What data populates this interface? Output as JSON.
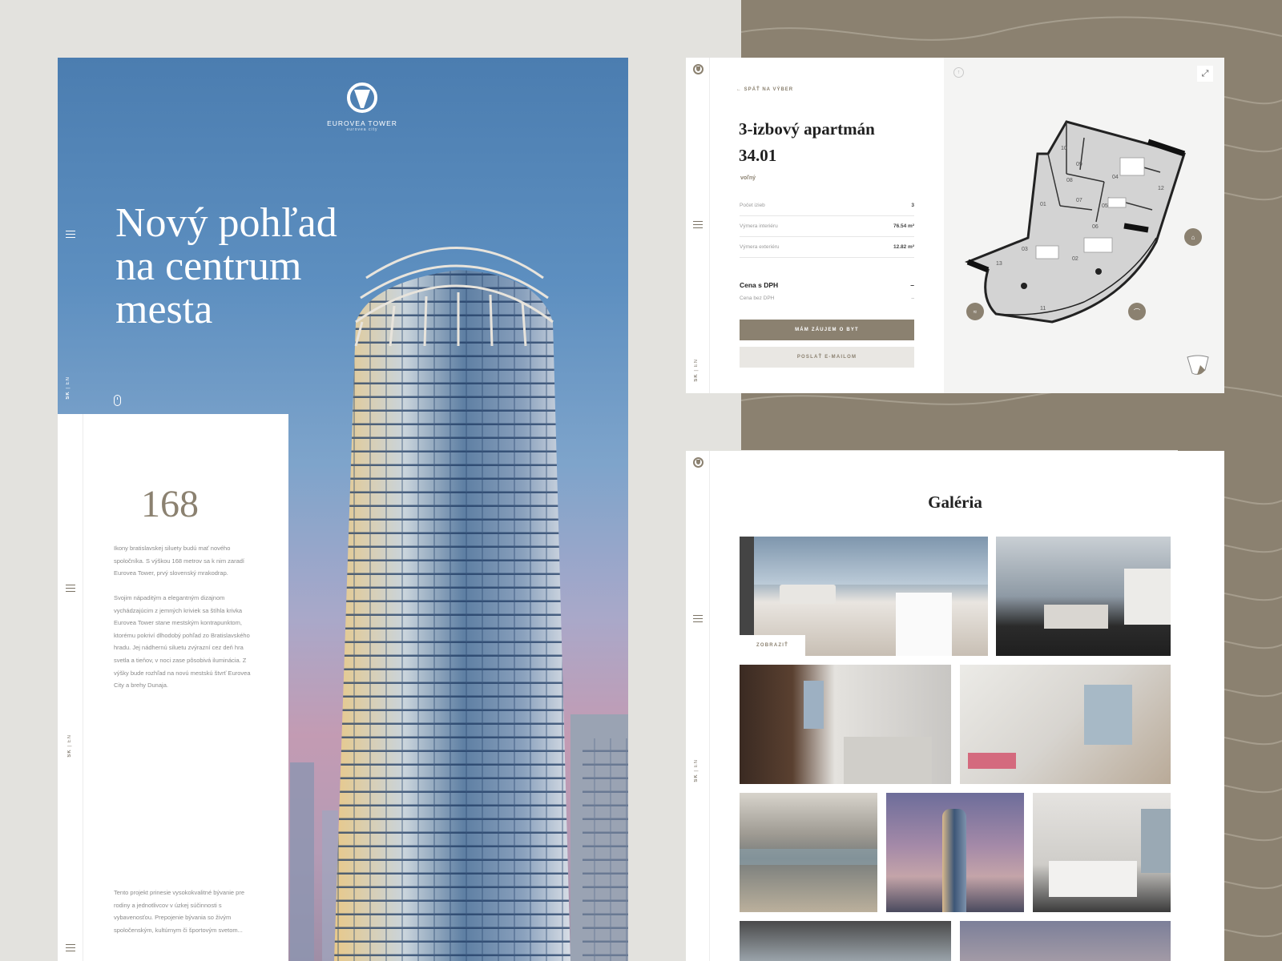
{
  "hero": {
    "brand": "EUROVEA TOWER",
    "brand_sub": "eurovea city",
    "title_lines": [
      "Nový pohľad",
      "na centrum",
      "mesta"
    ],
    "lang_sk": "SK",
    "lang_sep": "|",
    "lang_en": "EN"
  },
  "info": {
    "number": "168",
    "para1": "Ikony bratislavskej siluety budú mať nového spoločníka. S výškou 168 metrov sa k nim zaradí Eurovea Tower, prvý slovenský mrakodrap.",
    "para2": "Svojim nápaditým a elegantným dizajnom vychádzajúcim z jemných kriviek sa štíhla krivka Eurovea Tower stane mestským kontrapunktom, ktorému pokriví dlhodobý pohľad zo Bratislavského hradu. Jej nádhernú siluetu zvýrazní cez deň hra svetla a tieňov, v noci zase pôsobivá iluminácia. Z výšky bude rozhľad na novú mestskú štvrť Eurovea City a brehy Dunaja.",
    "para3": "Tento projekt prinesie vysokokvalitné bývanie pre rodiny a jednotlivcov v úzkej súčinnosti s vybavenosťou. Prepojenie bývania so živým spoločenským, kultúrnym či športovým svetom..."
  },
  "apartment": {
    "back": "← SPÄŤ NA VÝBER",
    "title_line1": "3-izbový apartmán",
    "title_line2": "34.01",
    "status": "voľný",
    "specs": [
      {
        "label": "Počet izieb",
        "value": "3"
      },
      {
        "label": "Výmera interiéru",
        "value": "76.54 m²"
      },
      {
        "label": "Výmera exteriéru",
        "value": "12.82 m²"
      }
    ],
    "price_label": "Cena s DPH",
    "price_value": "–",
    "price_net_label": "Cena bez DPH",
    "price_net_value": "–",
    "btn_interest": "MÁM ZÁUJEM O BYT",
    "btn_email": "POSLAŤ E-MAILOM",
    "room_numbers": [
      "01",
      "02",
      "03",
      "04",
      "05",
      "06",
      "07",
      "08",
      "09",
      "10",
      "11",
      "12",
      "13"
    ]
  },
  "gallery": {
    "title": "Galéria",
    "show": "ZOBRAZIŤ"
  },
  "colors": {
    "accent": "#8b8170",
    "background": "#e3e2de",
    "sky_top": "#4b7db0",
    "sky_bottom": "#c39bb3"
  }
}
